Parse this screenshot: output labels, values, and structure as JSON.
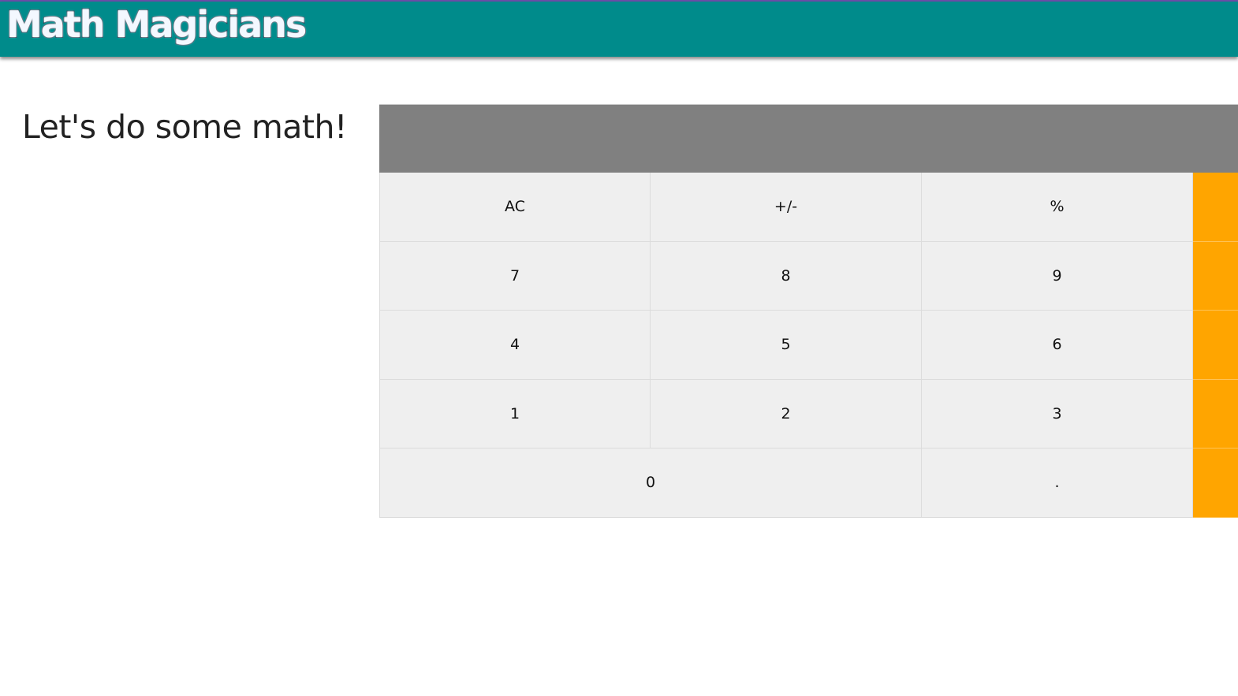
{
  "header": {
    "logo": "Math Magicians"
  },
  "main": {
    "heading": "Let's do some math!"
  },
  "calculator": {
    "display": "",
    "rows": [
      [
        "AC",
        "+/-",
        "%"
      ],
      [
        "7",
        "8",
        "9"
      ],
      [
        "4",
        "5",
        "6"
      ],
      [
        "1",
        "2",
        "3"
      ]
    ],
    "zero": "0",
    "dot": "."
  },
  "colors": {
    "header": "#008b8b",
    "display": "#808080",
    "key": "#efefef",
    "operator": "#ffa500"
  }
}
